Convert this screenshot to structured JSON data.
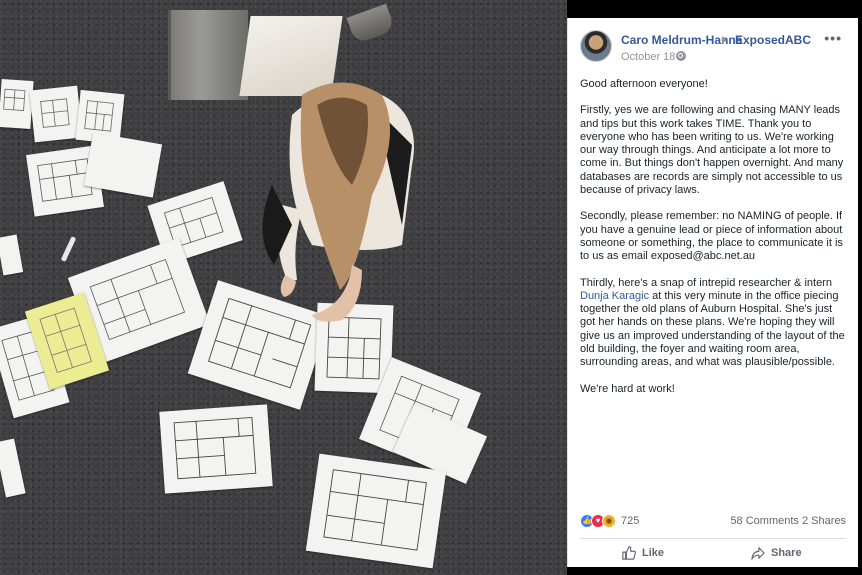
{
  "post": {
    "author": "Caro Meldrum-Hanna",
    "page": "ExposedABC",
    "date": "October 18",
    "more": "•••",
    "paragraphs": [
      "Good afternoon everyone!",
      "Firstly, yes we are following and chasing MANY leads and tips but this work takes TIME. Thank you to everyone who has been writing to us. We're working our way through things. And anticipate a lot more to come in. But things don't happen overnight. And many databases are records are simply not accessible to us because of privacy laws.",
      "Secondly, please remember: no NAMING of people. If you have a genuine lead or piece of information about someone or something, the place to communicate it is to us as email exposed@abc.net.au"
    ],
    "third_intro": "Thirdly, here's a snap of intrepid researcher & intern ",
    "third_link": "Dunja Karagic",
    "third_rest": " at this very minute in the office piecing together the old plans of Auburn Hospital. She's just got her hands on these plans. We're hoping they will give us an improved understanding of the layout of the old building, the foyer and waiting room area, surrounding areas, and what was plausible/possible.",
    "closing": "We're hard at work!",
    "reaction_count": "725",
    "comments_shares": "58 Comments  2 Shares",
    "like_label": "Like",
    "share_label": "Share"
  },
  "colors": {
    "link": "#365899",
    "text": "#1d2129",
    "muted": "#606770",
    "like_blue": "#2f7cf6",
    "love_red": "#f0284a",
    "wow_yellow": "#f7b125"
  },
  "icons": [
    "avatar",
    "arrow-icon",
    "more-icon",
    "globe-icon",
    "like-reaction-icon",
    "love-reaction-icon",
    "wow-reaction-icon",
    "thumbs-up-icon",
    "share-arrow-icon"
  ]
}
